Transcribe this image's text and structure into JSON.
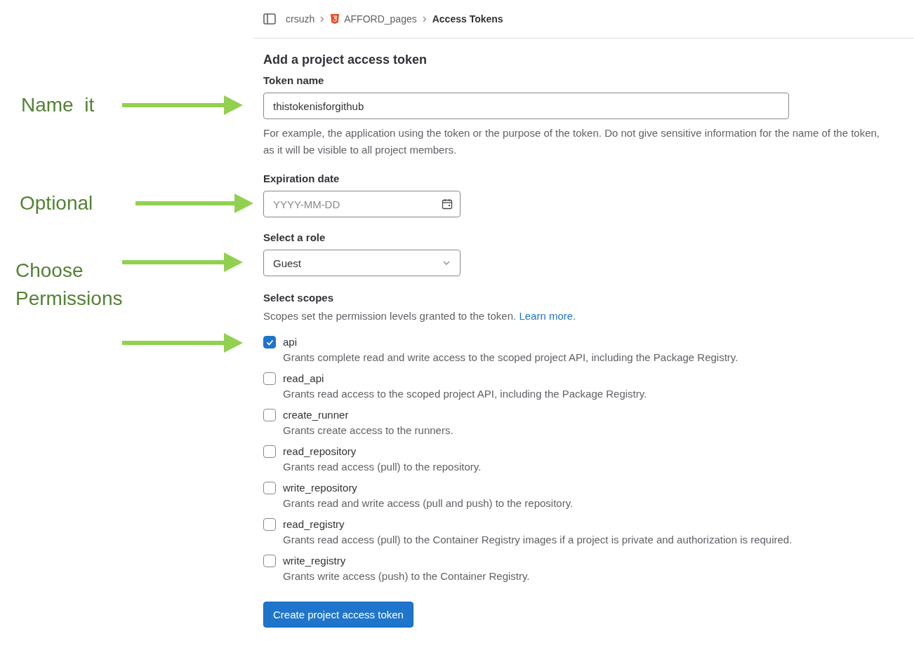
{
  "breadcrumbs": [
    {
      "label": "crsuzh",
      "kind": "group"
    },
    {
      "label": "AFFORD_pages",
      "kind": "project"
    },
    {
      "label": "Access Tokens",
      "kind": "current"
    }
  ],
  "title": "Add a project access token",
  "token_name": {
    "label": "Token name",
    "value": "thistokenisforgithub",
    "help": "For example, the application using the token or the purpose of the token. Do not give sensitive information for the name of the token, as it will be visible to all project members.",
    "note": "Name  it"
  },
  "expiration": {
    "label": "Expiration date",
    "placeholder": "YYYY-MM-DD",
    "note": "Optional"
  },
  "role": {
    "label": "Select a role",
    "value": "Guest",
    "note": "Choose Permissions"
  },
  "scopes": {
    "label": "Select scopes",
    "description": "Scopes set the permission levels granted to the token.",
    "link": "Learn more.",
    "items": [
      {
        "name": "api",
        "description": "Grants complete read and write access to the scoped project API, including the Package Registry.",
        "checked": true,
        "arrow": true
      },
      {
        "name": "read_api",
        "description": "Grants read access to the scoped project API, including the Package Registry.",
        "checked": false,
        "arrow": false
      },
      {
        "name": "create_runner",
        "description": "Grants create access to the runners.",
        "checked": false,
        "arrow": false
      },
      {
        "name": "read_repository",
        "description": "Grants read access (pull) to the repository.",
        "checked": false,
        "arrow": false
      },
      {
        "name": "write_repository",
        "description": "Grants read and write access (pull and push) to the repository.",
        "checked": false,
        "arrow": false
      },
      {
        "name": "read_registry",
        "description": "Grants read access (pull) to the Container Registry images if a project is private and authorization is required.",
        "checked": false,
        "arrow": false
      },
      {
        "name": "write_registry",
        "description": "Grants write access (push) to the Container Registry.",
        "checked": false,
        "arrow": false
      }
    ]
  },
  "submit": "Create project access token"
}
